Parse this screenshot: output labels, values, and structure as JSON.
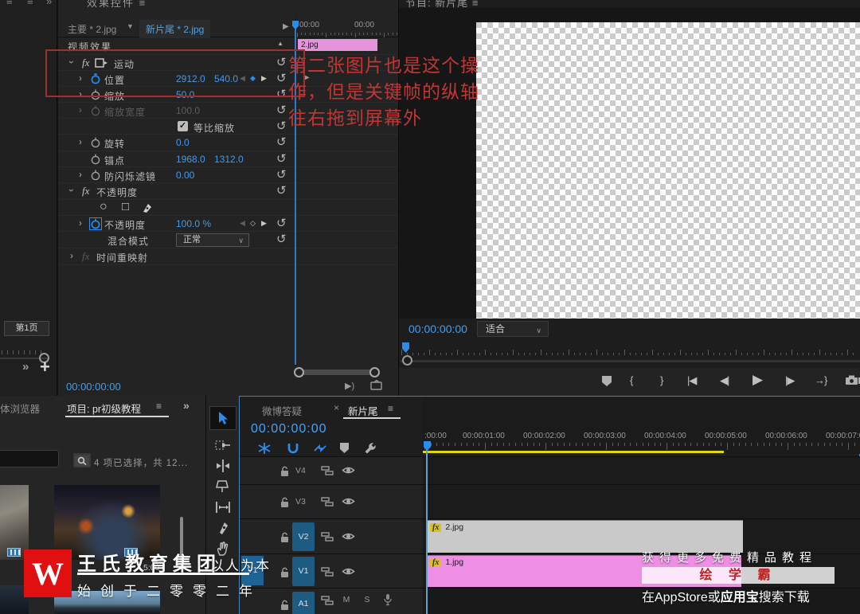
{
  "left_rail": {
    "page_badge": "第1页",
    "more": "»",
    "add": "+",
    "menu": "≡"
  },
  "effect_controls": {
    "panel_title": "效果控件",
    "menu": "≡",
    "source_tab": "主要 * 2.jpg",
    "sequence_tab": "新片尾 * 2.jpg",
    "video_effects": "视频效果",
    "motion": {
      "label": "运动"
    },
    "position": {
      "label": "位置",
      "x": "2912.0",
      "y": "540.0"
    },
    "scale": {
      "label": "缩放",
      "value": "50.0"
    },
    "scale_width": {
      "label": "缩放宽度",
      "value": "100.0"
    },
    "uniform_scale": {
      "label": "等比缩放"
    },
    "rotation": {
      "label": "旋转",
      "value": "0.0"
    },
    "anchor": {
      "label": "锚点",
      "x": "1968.0",
      "y": "1312.0"
    },
    "antiflicker": {
      "label": "防闪烁滤镜",
      "value": "0.00"
    },
    "opacity_group": {
      "label": "不透明度"
    },
    "opacity": {
      "label": "不透明度",
      "value": "100.0 %"
    },
    "blend_mode": {
      "label": "混合模式",
      "value": "正常"
    },
    "time_remapping": {
      "label": "时间重映射"
    },
    "mini_ruler": [
      "00:00",
      "00:00"
    ],
    "clip_chip": "2.jpg",
    "timecode": "00:00:00:00"
  },
  "program": {
    "panel_title": "节目: 新片尾",
    "menu": "≡",
    "timecode": "00:00:00:00",
    "zoom_level": "适合"
  },
  "annotation": {
    "line1": "第二张图片也是这个操",
    "line2": "作，但是关键帧的纵轴",
    "line3": "往右拖到屏幕外"
  },
  "project": {
    "tab_media_browser": "体浏览器",
    "tab_project": "项目: pr初级教程",
    "menu": "≡",
    "more": "»",
    "status": "4 项已选择，共 12...",
    "durations": [
      "5:",
      "5:00"
    ]
  },
  "timeline": {
    "tab_inactive": "微博答疑",
    "tab_close": "×",
    "tab_active": "新片尾",
    "menu": "≡",
    "timecode": "00:00:00:00",
    "ruler_labels": [
      ":00:00",
      "00:00:01:00",
      "00:00:02:00",
      "00:00:03:00",
      "00:00:04:00",
      "00:00:05:00",
      "00:00:06:00",
      "00:00:07:00"
    ],
    "source_patch": "V1",
    "tracks": {
      "v4": "V4",
      "v3": "V3",
      "v2": "V2",
      "v1": "V1",
      "a1": "A1"
    },
    "audio_mute": "M",
    "audio_solo": "S",
    "clip_v2": {
      "fx": "fx",
      "name": "2.jpg"
    },
    "clip_v1": {
      "fx": "fx",
      "name": "1.jpg"
    }
  },
  "watermark": {
    "logo_letter": "W",
    "brand": "王氏教育集团",
    "slogan": "以人为本",
    "founded": "始创于二零零二年",
    "promo_line1": "获得更多免费精品教程",
    "promo_app": "绘 学 霸",
    "promo_line2_prefix": "在AppStore或",
    "promo_line2_bold": "应用宝",
    "promo_line2_suffix": "搜索下载"
  },
  "icons": {
    "chev": "›",
    "reset": "↺",
    "kf_prev": "◀",
    "kf_diamond": "◆",
    "kf_diamond_hollow": "◇",
    "kf_next": "▶",
    "dropdown": "∨",
    "collapse": "▲",
    "play": "▶",
    "film_play": "▶",
    "bracket_open": "{",
    "bracket_close": "}",
    "to_in": "|◀",
    "step_back": "◀|",
    "step_fwd": "|▶",
    "to_out": "→}",
    "menu": "≡",
    "check": "✓",
    "mask_ellipse": "○",
    "mask_rect": "□",
    "play_around": "▶)"
  },
  "colors": {
    "accent_blue": "#2d8ceb",
    "value_blue": "#4699e8",
    "timecode_blue": "#3ba0f5",
    "clip_pink": "#ee8ee4",
    "clip_gray": "#c9c9c9",
    "annotation_red": "#c23535",
    "workarea_yellow": "#e2d613",
    "logo_red": "#e01010"
  }
}
